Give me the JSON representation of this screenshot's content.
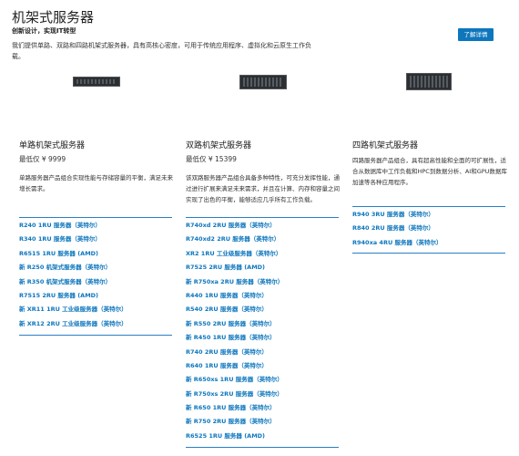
{
  "header": {
    "title": "机架式服务器",
    "subtitle": "创新设计，实现IT转型",
    "description": "我们提供单路、双路和四路机架式服务器，具有高核心密度，可用于传统应用程序、虚拟化和云原生工作负载。",
    "cta_label": "了解详情"
  },
  "columns": [
    {
      "title": "单路机架式服务器",
      "price": "最低仅 ¥ 9999",
      "description": "单路服务器产品组合实现性能与存储容量的平衡，满足未来增长需求。",
      "links": [
        "R240 1RU 服务器（英特尔）",
        "R340 1RU 服务器（英特尔）",
        "R6515 1RU 服务器 (AMD)",
        "新 R250 机架式服务器（英特尔）",
        "新 R350 机架式服务器（英特尔）",
        "R7515 2RU 服务器 (AMD)",
        "新 XR11 1RU 工业级服务器（英特尔）",
        "新 XR12 2RU 工业级服务器（英特尔）"
      ]
    },
    {
      "title": "双路机架式服务器",
      "price": "最低仅 ¥ 15399",
      "description": "该双路服务器产品组合具备多种特性，可充分发挥性能，通过进行扩展来满足未来需求，并且在计算、内存和容量之间实现了出色的平衡，能够适应几乎所有工作负载。",
      "links": [
        "R740xd 2RU 服务器（英特尔）",
        "R740xd2 2RU 服务器（英特尔）",
        "XR2 1RU 工业级服务器（英特尔）",
        "R7525 2RU 服务器 (AMD)",
        "新 R750xa 2RU 服务器（英特尔）",
        "R440 1RU 服务器（英特尔）",
        "R540 2RU 服务器（英特尔）",
        "新 R550 2RU 服务器（英特尔）",
        "新 R450 1RU 服务器（英特尔）",
        "R740 2RU 服务器（英特尔）",
        "R640 1RU 服务器（英特尔）",
        "新 R650xs 1RU 服务器（英特尔）",
        "新 R750xs 2RU 服务器（英特尔）",
        "新 R650 1RU 服务器（英特尔）",
        "新 R750 2RU 服务器（英特尔）",
        "R6525 1RU 服务器 (AMD)"
      ]
    },
    {
      "title": "四路机架式服务器",
      "price": "",
      "description": "四路服务器产品组合，具有超高性能和全面的可扩展性，适合从数据库中工作负载和HPC到数据分析、AI和GPU数据库加速等各种应用程序。",
      "links": [
        "R940 3RU 服务器（英特尔）",
        "R840 2RU 服务器（英特尔）",
        "R940xa 4RU 服务器（英特尔）"
      ]
    }
  ]
}
